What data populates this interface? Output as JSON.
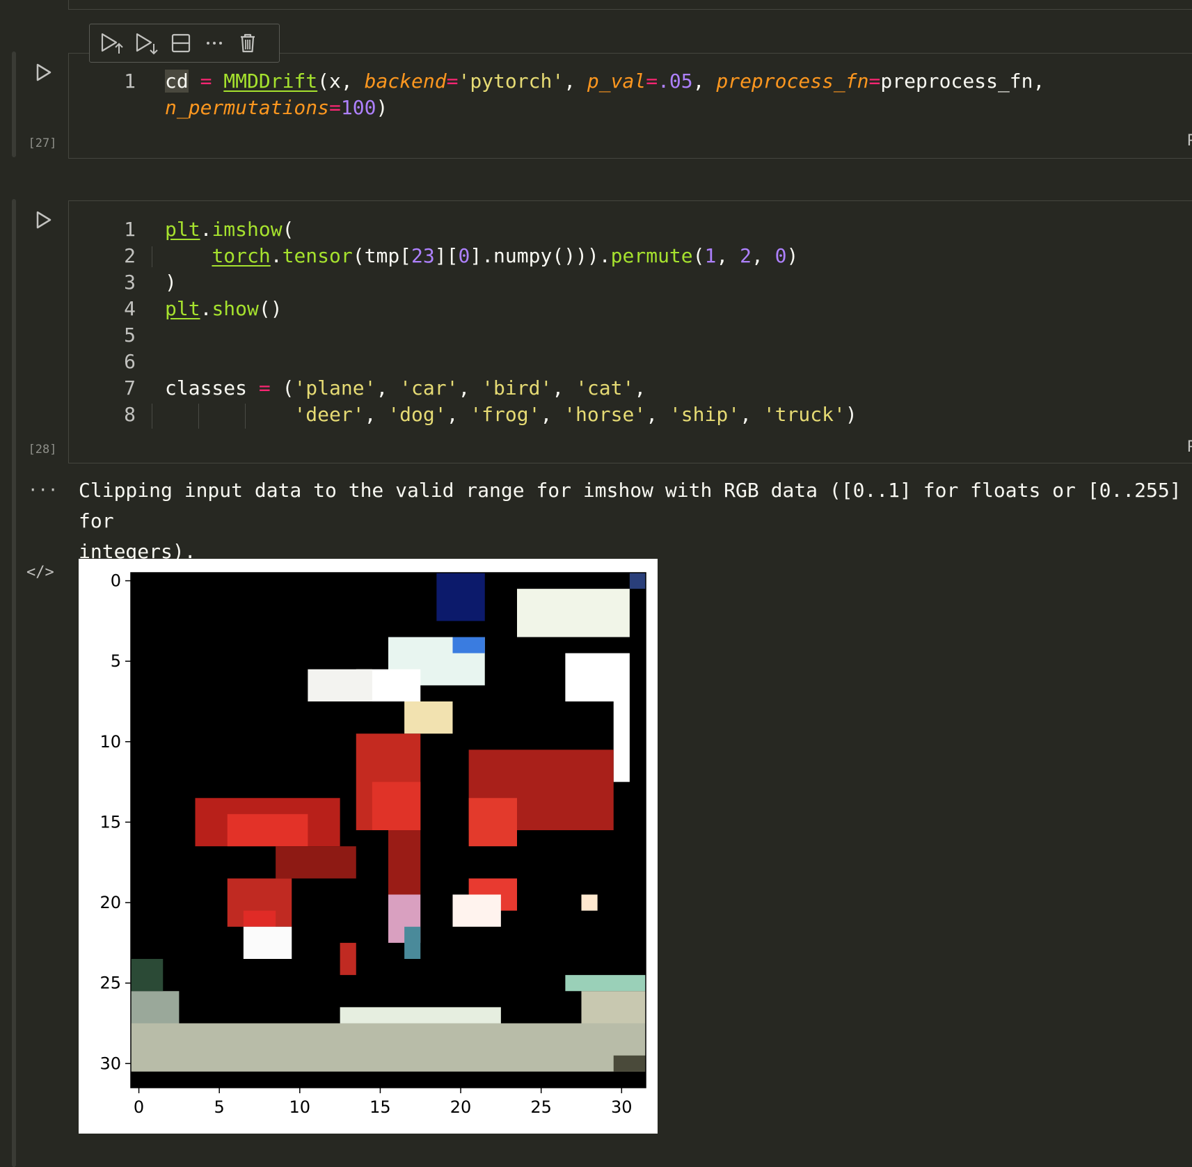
{
  "cells": [
    {
      "exec_count": "[27]",
      "lines": [
        {
          "n": "1",
          "segments": [
            {
              "t": "cd",
              "c": "sel"
            },
            {
              "t": " "
            },
            {
              "t": "=",
              "c": "pk"
            },
            {
              "t": " "
            },
            {
              "t": "MMDDrift",
              "c": "kw und"
            },
            {
              "t": "(x, "
            },
            {
              "t": "backend",
              "c": "par"
            },
            {
              "t": "=",
              "c": "pk"
            },
            {
              "t": "'pytorch'",
              "c": "str"
            },
            {
              "t": ", "
            },
            {
              "t": "p_val",
              "c": "par"
            },
            {
              "t": "=",
              "c": "pk"
            },
            {
              "t": ".05",
              "c": "num"
            },
            {
              "t": ", "
            },
            {
              "t": "preprocess_fn",
              "c": "par"
            },
            {
              "t": "=",
              "c": "pk"
            },
            {
              "t": "preprocess_fn,"
            }
          ]
        },
        {
          "n": "",
          "segments": [
            {
              "t": "n_permutations",
              "c": "par"
            },
            {
              "t": "=",
              "c": "pk"
            },
            {
              "t": "100",
              "c": "num"
            },
            {
              "t": ")"
            }
          ]
        }
      ]
    },
    {
      "exec_count": "[28]",
      "lines": [
        {
          "n": "1",
          "segments": [
            {
              "t": "plt",
              "c": "kw und"
            },
            {
              "t": "."
            },
            {
              "t": "imshow",
              "c": "kw"
            },
            {
              "t": "("
            }
          ]
        },
        {
          "n": "2",
          "segments": [
            {
              "t": "    "
            },
            {
              "t": "torch",
              "c": "kw und"
            },
            {
              "t": "."
            },
            {
              "t": "tensor",
              "c": "kw"
            },
            {
              "t": "(tmp["
            },
            {
              "t": "23",
              "c": "num"
            },
            {
              "t": "]["
            },
            {
              "t": "0",
              "c": "num"
            },
            {
              "t": "].numpy()))."
            },
            {
              "t": "permute",
              "c": "kw"
            },
            {
              "t": "("
            },
            {
              "t": "1",
              "c": "num"
            },
            {
              "t": ", "
            },
            {
              "t": "2",
              "c": "num"
            },
            {
              "t": ", "
            },
            {
              "t": "0",
              "c": "num"
            },
            {
              "t": ")"
            }
          ]
        },
        {
          "n": "3",
          "segments": [
            {
              "t": ")"
            }
          ]
        },
        {
          "n": "4",
          "segments": [
            {
              "t": "plt",
              "c": "kw und"
            },
            {
              "t": "."
            },
            {
              "t": "show",
              "c": "kw"
            },
            {
              "t": "()"
            }
          ]
        },
        {
          "n": "5",
          "segments": []
        },
        {
          "n": "6",
          "segments": []
        },
        {
          "n": "7",
          "segments": [
            {
              "t": "classes "
            },
            {
              "t": "=",
              "c": "pk"
            },
            {
              "t": " ("
            },
            {
              "t": "'plane'",
              "c": "str"
            },
            {
              "t": ", "
            },
            {
              "t": "'car'",
              "c": "str"
            },
            {
              "t": ", "
            },
            {
              "t": "'bird'",
              "c": "str"
            },
            {
              "t": ", "
            },
            {
              "t": "'cat'",
              "c": "str"
            },
            {
              "t": ","
            }
          ]
        },
        {
          "n": "8",
          "segments": [
            {
              "t": "           "
            },
            {
              "t": "'deer'",
              "c": "str"
            },
            {
              "t": ", "
            },
            {
              "t": "'dog'",
              "c": "str"
            },
            {
              "t": ", "
            },
            {
              "t": "'frog'",
              "c": "str"
            },
            {
              "t": ", "
            },
            {
              "t": "'horse'",
              "c": "str"
            },
            {
              "t": ", "
            },
            {
              "t": "'ship'",
              "c": "str"
            },
            {
              "t": ", "
            },
            {
              "t": "'truck'",
              "c": "str"
            },
            {
              "t": ")"
            }
          ]
        }
      ]
    }
  ],
  "right_tag": "P",
  "output": {
    "more_glyph": "···",
    "code_glyph": "</>",
    "warning": "Clipping input data to the valid range for imshow with RGB data ([0..1] for floats or [0..255] for\nintegers).",
    "x_ticks": [
      "0",
      "5",
      "10",
      "15",
      "20",
      "25",
      "30"
    ],
    "y_ticks": [
      "0",
      "5",
      "10",
      "15",
      "20",
      "25",
      "30"
    ],
    "bg_color": "#000000",
    "fg_color": "#d63a2e"
  },
  "toolbar": {
    "icons": [
      "run-above-icon",
      "run-below-icon",
      "split-cell-icon",
      "more-icon",
      "delete-icon"
    ]
  }
}
